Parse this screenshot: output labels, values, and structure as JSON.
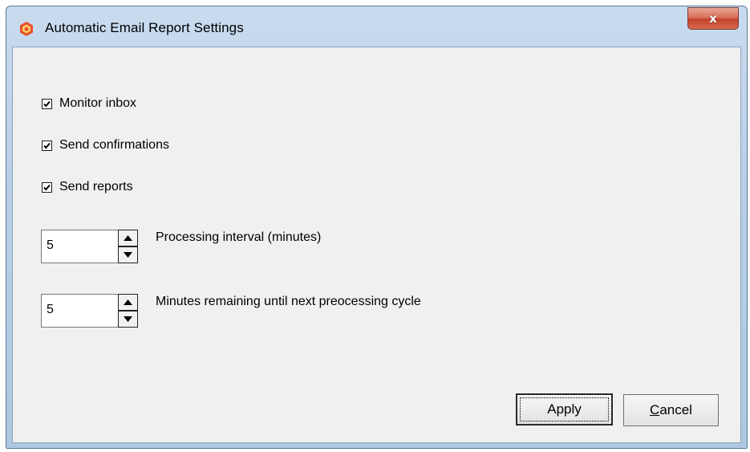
{
  "window": {
    "title": "Automatic Email Report Settings",
    "close_glyph": "x"
  },
  "checkboxes": [
    {
      "label": "Monitor inbox",
      "checked": true
    },
    {
      "label": "Send confirmations",
      "checked": true
    },
    {
      "label": "Send reports",
      "checked": true
    }
  ],
  "spinners": [
    {
      "value": "5",
      "label": "Processing interval (minutes)"
    },
    {
      "value": "5",
      "label": "Minutes remaining until next preocessing cycle"
    }
  ],
  "buttons": {
    "apply_label": "Apply",
    "cancel_first": "C",
    "cancel_rest": "ancel"
  },
  "colors": {
    "title_gradient_top": "#c9dcef",
    "close_red": "#c4432c",
    "client_bg": "#f0f0f0"
  },
  "icons": {
    "app": "app-logo-icon",
    "close": "close-icon",
    "check": "checkmark-icon",
    "up": "spin-up-arrow-icon",
    "down": "spin-down-arrow-icon"
  }
}
